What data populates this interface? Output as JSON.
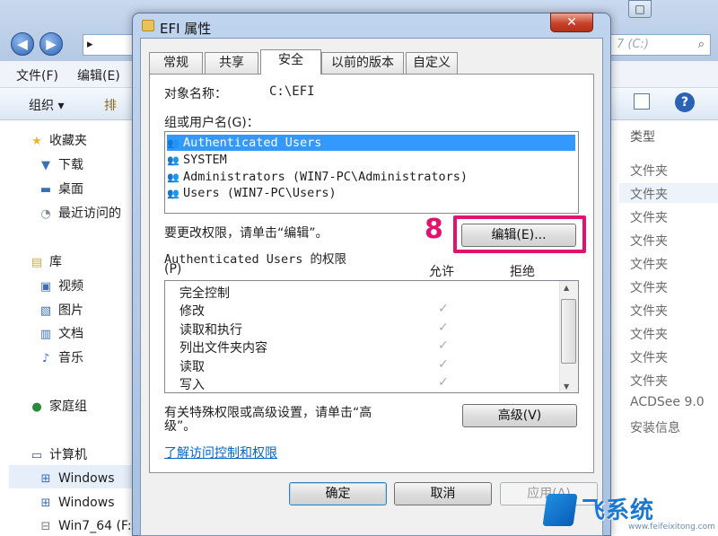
{
  "explorer": {
    "address_left": "▸",
    "address_right": "7 (C:)",
    "menu": {
      "file": "文件(F)",
      "edit": "编辑(E)"
    },
    "toolbar": {
      "organize": "组织 ▾",
      "truncated": "排"
    },
    "nav_items": [
      {
        "label": "收藏夹",
        "icon": "star-icon"
      },
      {
        "label": "下载",
        "icon": "download-folder-icon"
      },
      {
        "label": "桌面",
        "icon": "desktop-icon"
      },
      {
        "label": "最近访问的",
        "icon": "recent-places-icon"
      },
      {
        "label": "库",
        "icon": "library-icon"
      },
      {
        "label": "视频",
        "icon": "video-library-icon"
      },
      {
        "label": "图片",
        "icon": "pictures-library-icon"
      },
      {
        "label": "文档",
        "icon": "documents-library-icon"
      },
      {
        "label": "音乐",
        "icon": "music-library-icon"
      },
      {
        "label": "家庭组",
        "icon": "homegroup-icon"
      },
      {
        "label": "计算机",
        "icon": "computer-icon"
      },
      {
        "label": "Windows",
        "icon": "drive-icon"
      },
      {
        "label": "Windows",
        "icon": "drive-icon"
      },
      {
        "label": "Win7_64 (F:",
        "icon": "drive-icon"
      }
    ],
    "type_header": "类型",
    "type_cells": [
      "文件夹",
      "文件夹",
      "文件夹",
      "文件夹",
      "文件夹",
      "文件夹",
      "文件夹",
      "文件夹",
      "文件夹",
      "ACDSee 9.0",
      "安装信息"
    ]
  },
  "dialog": {
    "title": "EFI 属性",
    "close": "✕",
    "tabs": [
      "常规",
      "共享",
      "安全",
      "以前的版本",
      "自定义"
    ],
    "active_tab": "安全",
    "object_label": "对象名称：",
    "object_value": "C:\\EFI",
    "group_label": "组或用户名(G)：",
    "users": [
      "Authenticated Users",
      "SYSTEM",
      "Administrators (WIN7-PC\\Administrators)",
      "Users (WIN7-PC\\Users)"
    ],
    "change_hint": "要更改权限，请单击“编辑”。",
    "edit_button": "编辑(E)...",
    "step_number": "8",
    "perm_title_line1": "Authenticated Users 的权限",
    "perm_title_line2": "(P)",
    "allow_header": "允许",
    "deny_header": "拒绝",
    "permissions": [
      {
        "name": "完全控制",
        "allow": false
      },
      {
        "name": "修改",
        "allow": true
      },
      {
        "name": "读取和执行",
        "allow": true
      },
      {
        "name": "列出文件夹内容",
        "allow": true
      },
      {
        "name": "读取",
        "allow": true
      },
      {
        "name": "写入",
        "allow": true
      }
    ],
    "check_mark": "✓",
    "special_hint_line1": "有关特殊权限或高级设置，请单击“高",
    "special_hint_line2": "级”。",
    "advanced_button": "高级(V)",
    "learn_link": "了解访问控制和权限",
    "ok_button": "确定",
    "cancel_button": "取消",
    "apply_button": "应用(A)"
  },
  "watermark": {
    "brand": "飞系统",
    "sub": "www.feifeixitong.com"
  },
  "colors": {
    "highlight": "#e0146e",
    "selection": "#3399ff",
    "link": "#0066cc"
  }
}
